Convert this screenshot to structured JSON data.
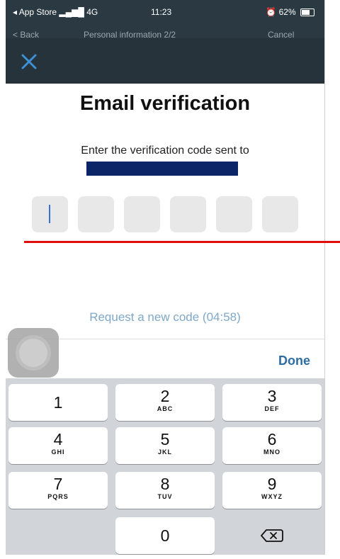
{
  "status_bar": {
    "carrier": "◂ App Store",
    "network": "4G",
    "time": "11:23",
    "battery_percent": "62%"
  },
  "nav_ghost": {
    "back": "< Back",
    "title": "Personal information 2/2",
    "cancel": "Cancel"
  },
  "modal": {
    "title": "Email verification",
    "instruction": "Enter the verification code sent to",
    "code_length": 6,
    "request_code": "Request a new code (04:58)"
  },
  "toolbar": {
    "done_label": "Done"
  },
  "keypad": {
    "keys": [
      {
        "digit": "1",
        "letters": ""
      },
      {
        "digit": "2",
        "letters": "ABC"
      },
      {
        "digit": "3",
        "letters": "DEF"
      },
      {
        "digit": "4",
        "letters": "GHI"
      },
      {
        "digit": "5",
        "letters": "JKL"
      },
      {
        "digit": "6",
        "letters": "MNO"
      },
      {
        "digit": "7",
        "letters": "PQRS"
      },
      {
        "digit": "8",
        "letters": "TUV"
      },
      {
        "digit": "9",
        "letters": "WXYZ"
      },
      {
        "digit": "0",
        "letters": ""
      }
    ],
    "backspace_icon": "backspace-icon"
  },
  "colors": {
    "header_bg": "#27333a",
    "close_icon": "#3d8fd6",
    "link": "#7fa8c8",
    "done": "#2e6da4",
    "annotation": "#e10d0d",
    "redaction": "#0b2566"
  }
}
